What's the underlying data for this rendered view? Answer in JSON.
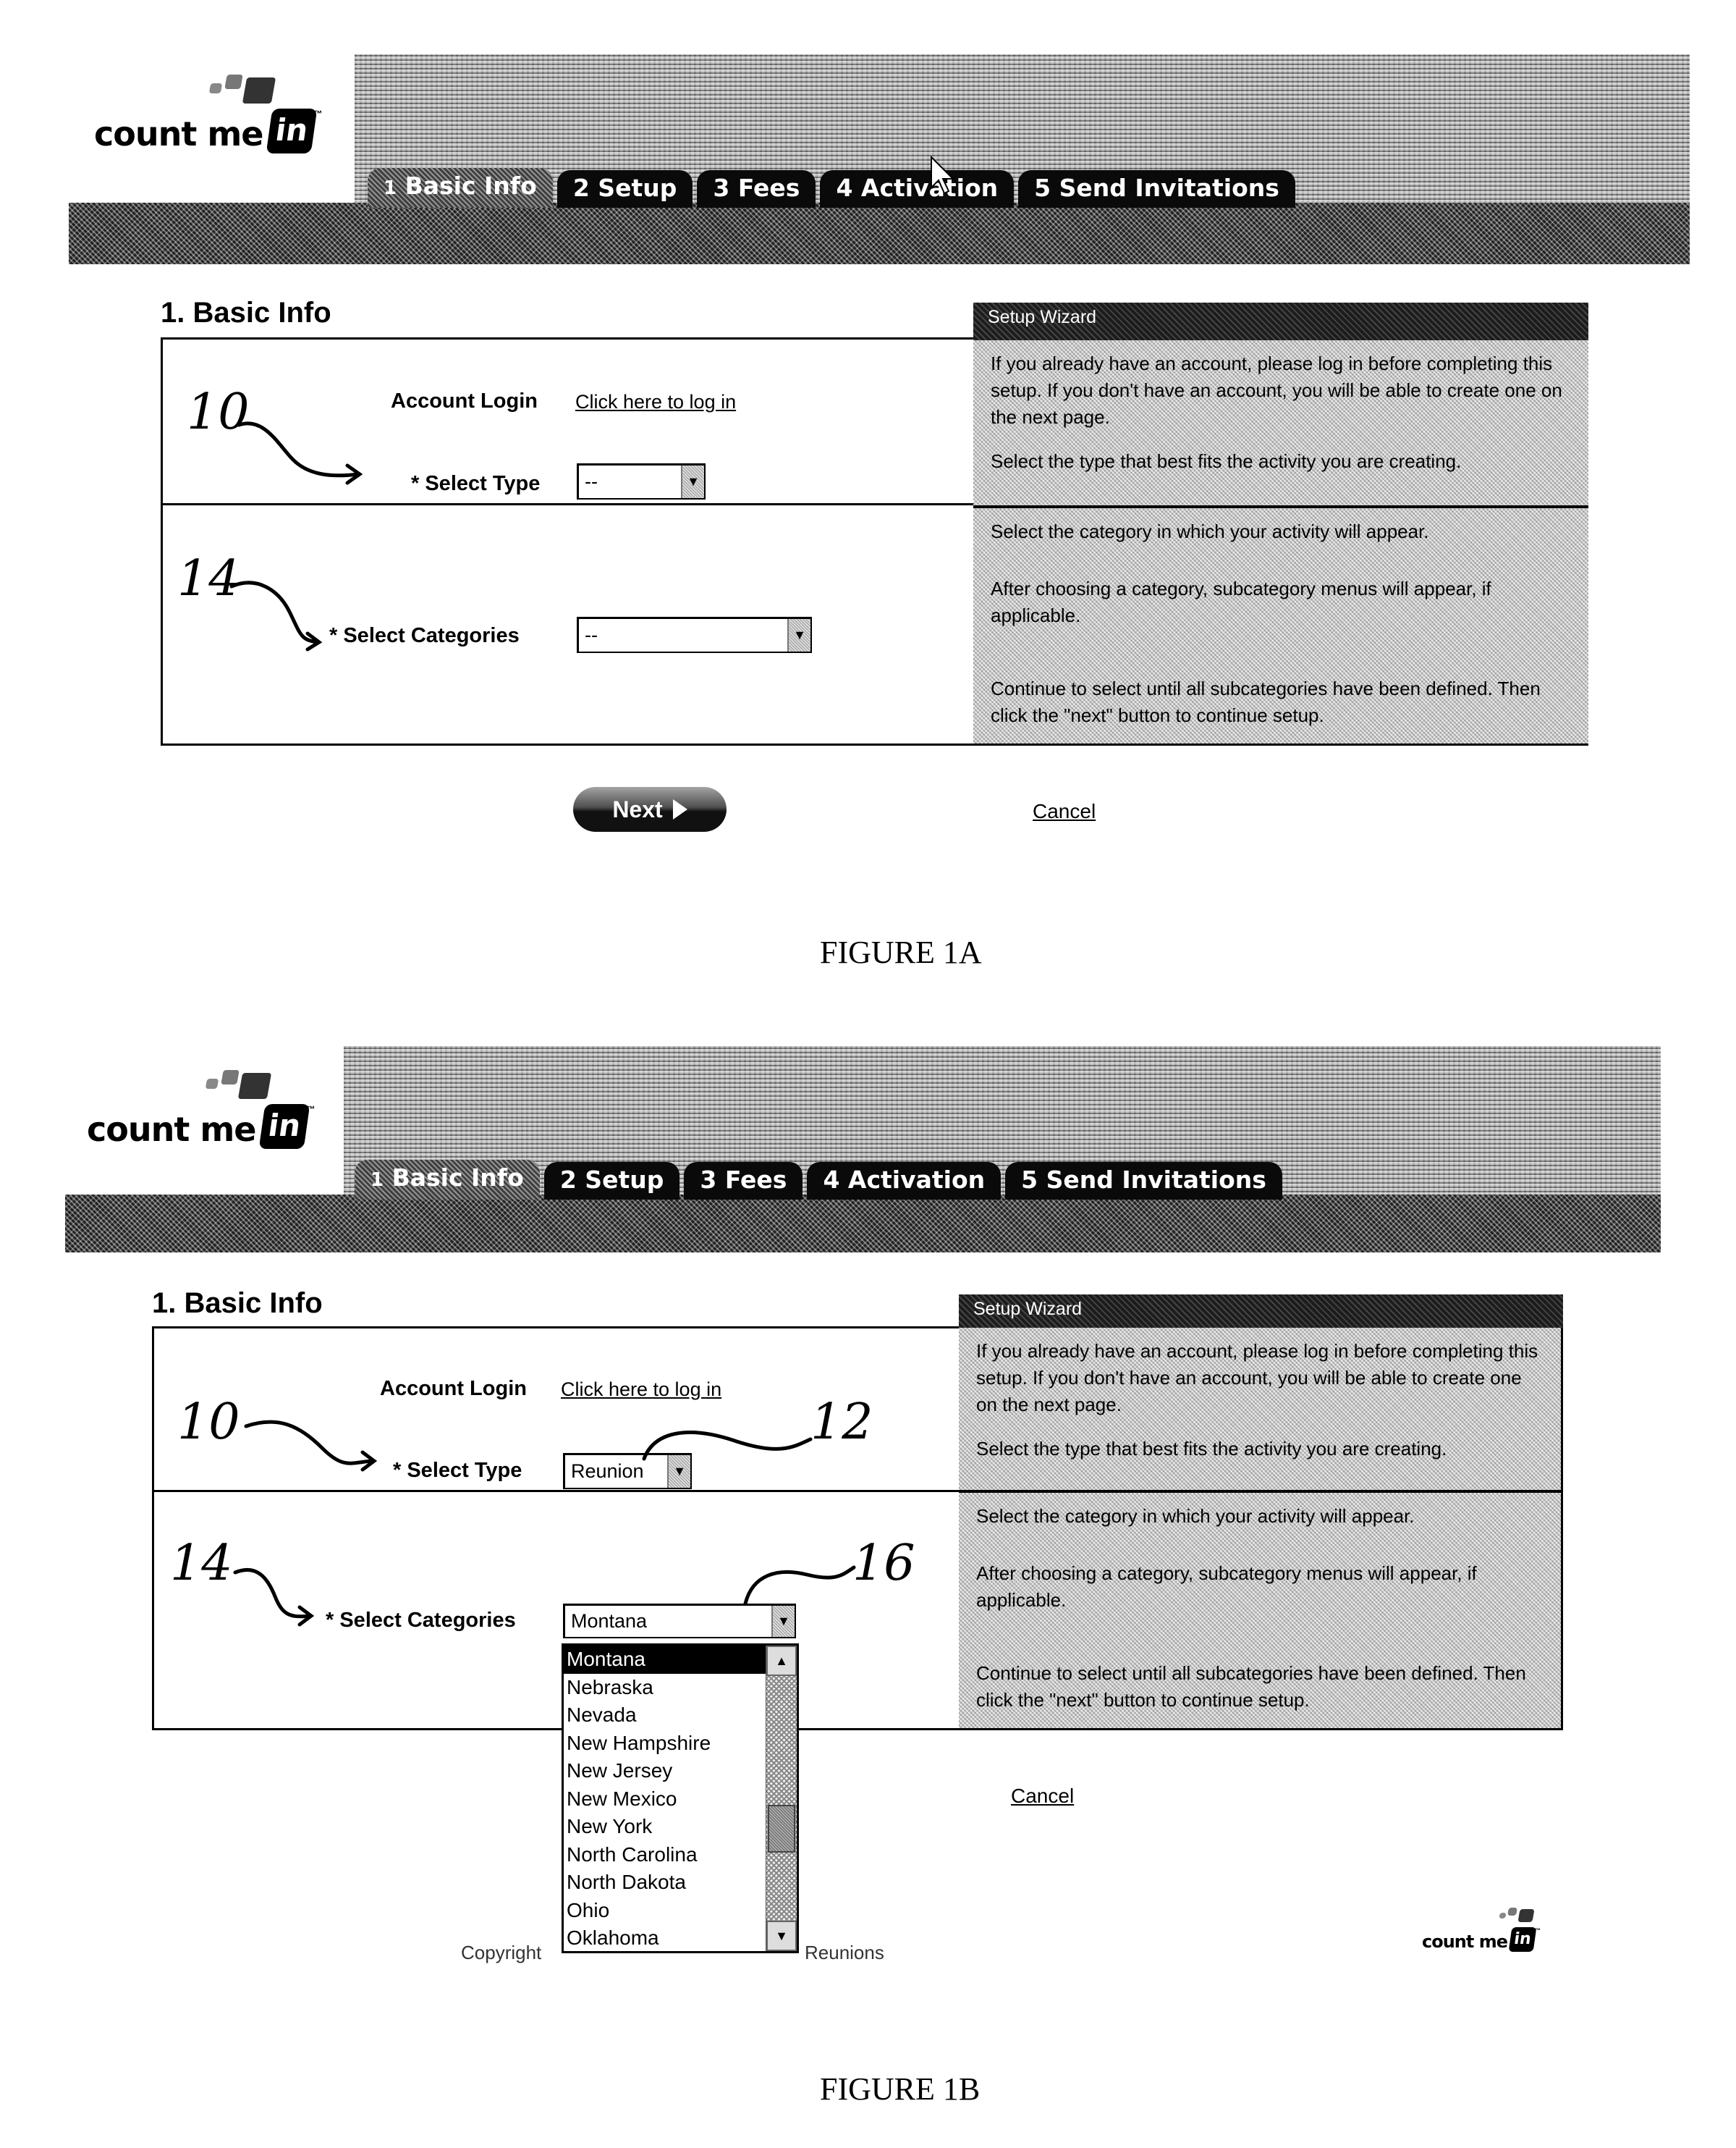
{
  "brand": {
    "logo_text": "count me",
    "logo_badge": "in",
    "trademark": "™"
  },
  "tabs": [
    {
      "num": "1",
      "label": "Basic Info"
    },
    {
      "num": "2",
      "label": "Setup"
    },
    {
      "num": "3",
      "label": "Fees"
    },
    {
      "num": "4",
      "label": "Activation"
    },
    {
      "num": "5",
      "label": "Send Invitations"
    }
  ],
  "active_tab": "1 Basic Info",
  "figure_a": {
    "caption": "FIGURE 1A",
    "page_title": "1. Basic Info",
    "account_login_label": "Account Login",
    "login_link": "Click here to log in",
    "select_type_label": "* Select Type",
    "select_type_value": "--",
    "select_categories_label": "* Select Categories",
    "select_categories_value": "--",
    "next_button": "Next",
    "cancel_link": "Cancel",
    "annotations": {
      "type_ref": "10",
      "categories_ref": "14"
    }
  },
  "figure_b": {
    "caption": "FIGURE 1B",
    "page_title": "1. Basic Info",
    "account_login_label": "Account Login",
    "login_link": "Click here to log in",
    "select_type_label": "* Select Type",
    "select_type_value": "Reunion",
    "select_categories_label": "* Select Categories",
    "select_categories_value": "Montana",
    "category_options": [
      "Montana",
      "Nebraska",
      "Nevada",
      "New Hampshire",
      "New Jersey",
      "New Mexico",
      "New York",
      "North Carolina",
      "North Dakota",
      "Ohio",
      "Oklahoma"
    ],
    "selected_option": "Montana",
    "cancel_link": "Cancel",
    "copyright_left": "Copyright",
    "copyright_right": "Reunions",
    "annotations": {
      "type_ref": "10",
      "type_value_ref": "12",
      "categories_ref": "14",
      "categories_list_ref": "16"
    }
  },
  "wizard": {
    "title": "Setup Wizard",
    "section1": [
      "If you already have an account, please log in before completing this setup. If you don't have an account, you will be able to create one on the next page.",
      "Select the type that best fits the activity you are creating."
    ],
    "section2": [
      "Select the category in which your activity will appear.",
      "After choosing a category, subcategory menus will appear, if applicable.",
      "Continue to select until all subcategories have been defined. Then click the \"next\" button to continue setup."
    ]
  }
}
